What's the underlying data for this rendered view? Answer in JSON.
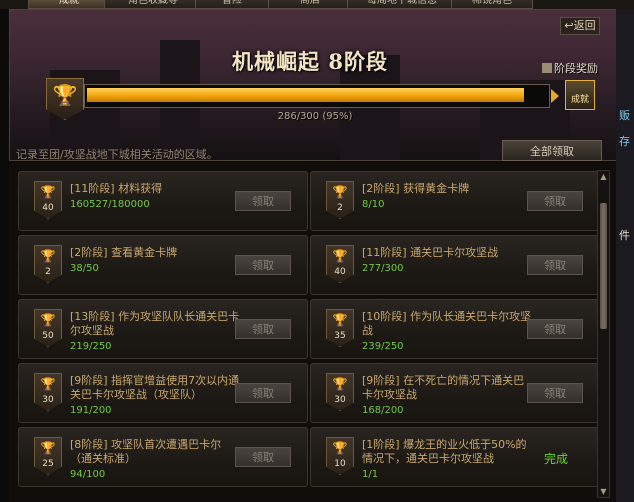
{
  "top_tabs": [
    {
      "label": "成就",
      "active": true
    },
    {
      "label": "角色收藏等",
      "active": false
    },
    {
      "label": "冒险",
      "active": false
    },
    {
      "label": "商店",
      "active": false
    },
    {
      "label": "每周地下城信息",
      "active": false
    },
    {
      "label": "稀镜角色",
      "active": false
    }
  ],
  "header": {
    "back_label": "返回",
    "back_icon": "return-arrow-icon",
    "stage_title": "机械崛起 8阶段",
    "reward_label": "阶段奖励",
    "badge_label": "成就",
    "progress_text": "286/300 (95%)",
    "progress_value": 0.95,
    "description": "记录至团/攻坚战地下城相关活动的区域。",
    "claim_all_label": "全部领取"
  },
  "colors": {
    "progress_fill": "#f2a50c",
    "task_title": "#c9a96e",
    "task_progress": "#74c94a",
    "done_text": "#6dd43a"
  },
  "tasks": [
    {
      "points": "40",
      "title": "[11阶段] 材料获得",
      "progress": "160527/180000",
      "action": "领取",
      "completed": false
    },
    {
      "points": "2",
      "title": "[2阶段] 获得黄金卡牌",
      "progress": "8/10",
      "action": "领取",
      "completed": false
    },
    {
      "points": "2",
      "title": "[2阶段] 查看黄金卡牌",
      "progress": "38/50",
      "action": "领取",
      "completed": false
    },
    {
      "points": "40",
      "title": "[11阶段] 通关巴卡尔攻坚战",
      "progress": "277/300",
      "action": "领取",
      "completed": false
    },
    {
      "points": "50",
      "title": "[13阶段] 作为攻坚队队长通关巴卡尔攻坚战",
      "progress": "219/250",
      "action": "领取",
      "completed": false
    },
    {
      "points": "35",
      "title": "[10阶段] 作为队长通关巴卡尔攻坚战",
      "progress": "239/250",
      "action": "领取",
      "completed": false
    },
    {
      "points": "30",
      "title": "[9阶段] 指挥官增益使用7次以内通关巴卡尔攻坚战（攻坚队）",
      "progress": "191/200",
      "action": "领取",
      "completed": false
    },
    {
      "points": "30",
      "title": "[9阶段] 在不死亡的情况下通关巴卡尔攻坚战",
      "progress": "168/200",
      "action": "领取",
      "completed": false
    },
    {
      "points": "25",
      "title": "[8阶段] 攻坚队首次遭遇巴卡尔（通关标准）",
      "progress": "94/100",
      "action": "领取",
      "completed": false
    },
    {
      "points": "10",
      "title": "[1阶段] 爆龙王的业火低于50%的情况下，通关巴卡尔攻坚战",
      "progress": "1/1",
      "action": "完成",
      "completed": true
    }
  ],
  "side_glyphs": [
    "贩",
    "存",
    "件"
  ]
}
